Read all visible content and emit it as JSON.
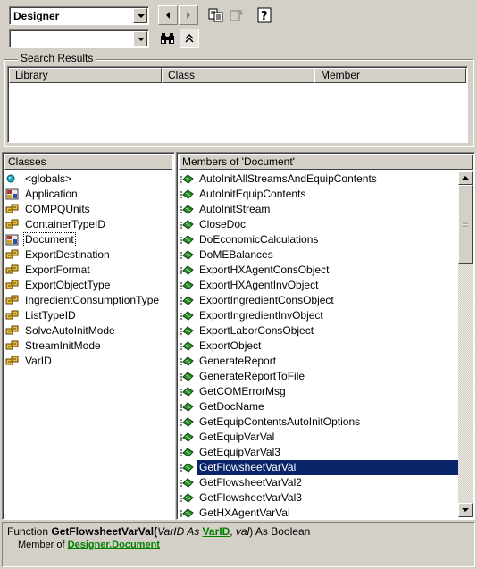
{
  "toolbar": {
    "library_combo": {
      "value": "Designer"
    },
    "search_combo": {
      "value": ""
    }
  },
  "search_results": {
    "title": "Search Results",
    "columns": [
      "Library",
      "Class",
      "Member"
    ]
  },
  "classes_pane": {
    "header": "Classes",
    "items": [
      {
        "label": "<globals>",
        "icon": "globals-icon"
      },
      {
        "label": "Application",
        "icon": "class-icon"
      },
      {
        "label": "COMPQUnits",
        "icon": "enum-icon"
      },
      {
        "label": "ContainerTypeID",
        "icon": "enum-icon"
      },
      {
        "label": "Document",
        "icon": "class-icon"
      },
      {
        "label": "ExportDestination",
        "icon": "enum-icon"
      },
      {
        "label": "ExportFormat",
        "icon": "enum-icon"
      },
      {
        "label": "ExportObjectType",
        "icon": "enum-icon"
      },
      {
        "label": "IngredientConsumptionType",
        "icon": "enum-icon"
      },
      {
        "label": "ListTypeID",
        "icon": "enum-icon"
      },
      {
        "label": "SolveAutoInitMode",
        "icon": "enum-icon"
      },
      {
        "label": "StreamInitMode",
        "icon": "enum-icon"
      },
      {
        "label": "VarID",
        "icon": "enum-icon"
      }
    ],
    "focused_index": 4
  },
  "members_pane": {
    "header": "Members of 'Document'",
    "items": [
      "AutoInitAllStreamsAndEquipContents",
      "AutoInitEquipContents",
      "AutoInitStream",
      "CloseDoc",
      "DoEconomicCalculations",
      "DoMEBalances",
      "ExportHXAgentConsObject",
      "ExportHXAgentInvObject",
      "ExportIngredientConsObject",
      "ExportIngredientInvObject",
      "ExportLaborConsObject",
      "ExportObject",
      "GenerateReport",
      "GenerateReportToFile",
      "GetCOMErrorMsg",
      "GetDocName",
      "GetEquipContentsAutoInitOptions",
      "GetEquipVarVal",
      "GetEquipVarVal3",
      "GetFlowsheetVarVal",
      "GetFlowsheetVarVal2",
      "GetFlowsheetVarVal3",
      "GetHXAgentVarVal"
    ],
    "selected_index": 19
  },
  "detail": {
    "prefix": "Function ",
    "name": "GetFlowsheetVarVal",
    "open_paren": "(",
    "param1": "VarID",
    "as1": " As ",
    "type1": "VarID",
    "sep": ", ",
    "param2": "val",
    "close": ") As Boolean",
    "member_of": "Member of ",
    "lib": "Designer",
    "dot": ".",
    "cls": "Document"
  },
  "colors": {
    "selection": "#0a246a",
    "link": "#008000",
    "method_icon": "#2e8b2e"
  }
}
